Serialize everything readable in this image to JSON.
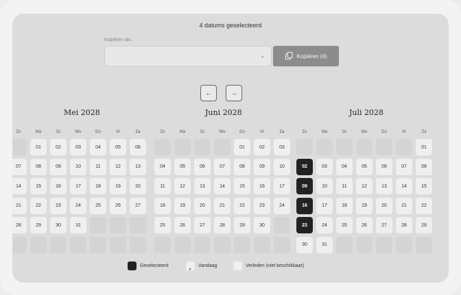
{
  "header": {
    "selection_summary": "4 datums geselecteerd"
  },
  "copy": {
    "label": "Kopiëren als",
    "select_value": "",
    "button_label": "Kopiëren (4)",
    "button_icon": "copy-icon"
  },
  "nav": {
    "prev_label": "←",
    "next_label": "→"
  },
  "weekdays": [
    "Zo",
    "Ma",
    "Di",
    "Wo",
    "Do",
    "Vr",
    "Za"
  ],
  "months": [
    {
      "title": "Mei 2028",
      "weeks": [
        [
          null,
          "01",
          "02",
          "03",
          "04",
          "05",
          "06"
        ],
        [
          "07",
          "08",
          "09",
          "10",
          "11",
          "12",
          "13"
        ],
        [
          "14",
          "15",
          "16",
          "17",
          "18",
          "19",
          "20"
        ],
        [
          "21",
          "22",
          "23",
          "24",
          "25",
          "26",
          "27"
        ],
        [
          "28",
          "29",
          "30",
          "31",
          null,
          null,
          null
        ],
        [
          null,
          null,
          null,
          null,
          null,
          null,
          null
        ]
      ],
      "selected": []
    },
    {
      "title": "Juni 2028",
      "weeks": [
        [
          null,
          null,
          null,
          null,
          "01",
          "02",
          "03"
        ],
        [
          "04",
          "05",
          "06",
          "07",
          "08",
          "09",
          "10"
        ],
        [
          "11",
          "12",
          "13",
          "14",
          "15",
          "16",
          "17"
        ],
        [
          "18",
          "19",
          "20",
          "21",
          "22",
          "23",
          "24"
        ],
        [
          "25",
          "26",
          "27",
          "28",
          "29",
          "30",
          null
        ],
        [
          null,
          null,
          null,
          null,
          null,
          null,
          null
        ]
      ],
      "selected": []
    },
    {
      "title": "Juli 2028",
      "weeks": [
        [
          null,
          null,
          null,
          null,
          null,
          null,
          "01"
        ],
        [
          "02",
          "03",
          "04",
          "05",
          "06",
          "07",
          "08"
        ],
        [
          "09",
          "10",
          "11",
          "12",
          "13",
          "14",
          "15"
        ],
        [
          "16",
          "17",
          "18",
          "19",
          "20",
          "21",
          "22"
        ],
        [
          "23",
          "24",
          "25",
          "26",
          "27",
          "28",
          "29"
        ],
        [
          "30",
          "31",
          null,
          null,
          null,
          null,
          null
        ]
      ],
      "selected": [
        "02",
        "09",
        "16",
        "23"
      ]
    }
  ],
  "legend": {
    "selected": "Geselecteerd",
    "today": "Vandaag",
    "past": "Verleden (niet beschikbaar)"
  },
  "colors": {
    "selected": "#222222",
    "day": "#efefef",
    "panel": "#dcdcdc",
    "copy_button": "#8c8c8c"
  }
}
